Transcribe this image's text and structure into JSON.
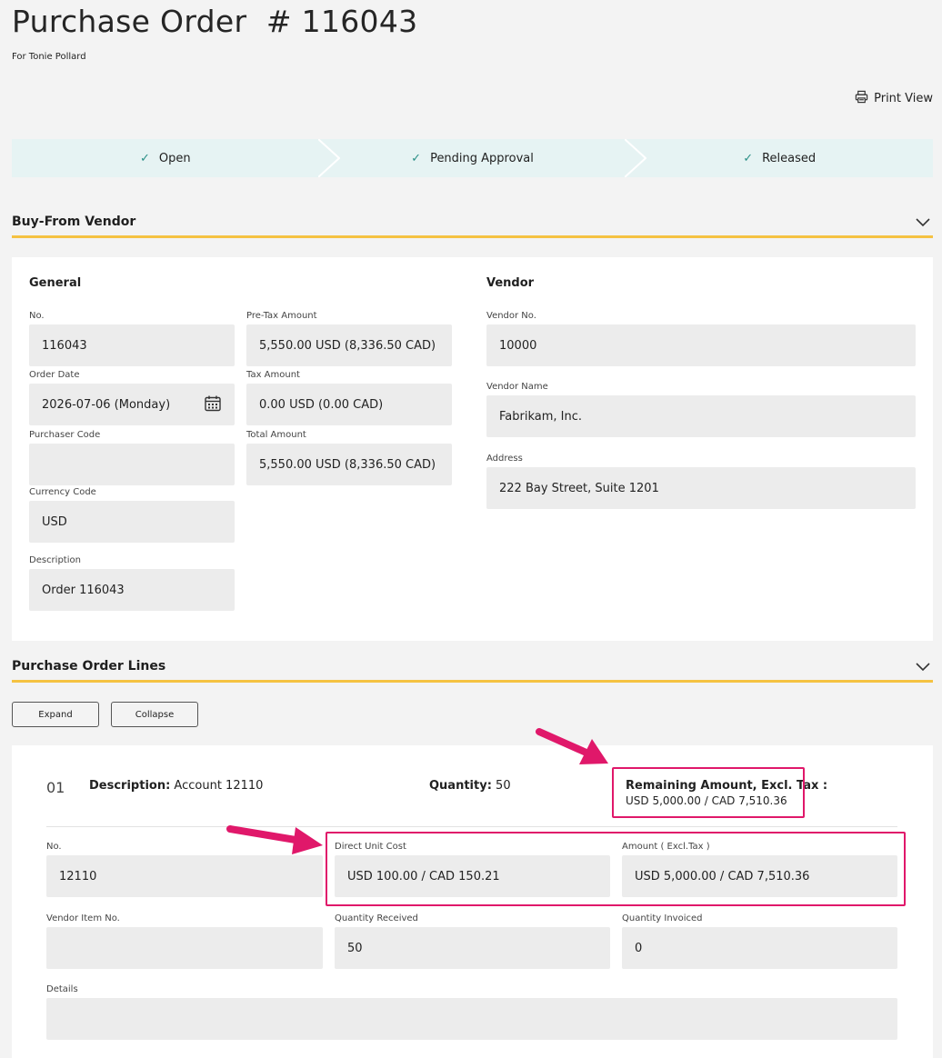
{
  "page": {
    "title": "Purchase Order  # 116043",
    "subtitle": "For Tonie Pollard",
    "print_label": "Print View"
  },
  "status_steps": [
    "Open",
    "Pending Approval",
    "Released"
  ],
  "colors": {
    "accent_underline": "#f5c242",
    "highlight": "#e0186a",
    "check": "#2a8f86",
    "progress_bg": "#e6f3f3"
  },
  "vendor_section": {
    "header": "Buy-From Vendor",
    "general": {
      "title": "General",
      "no_label": "No.",
      "no_value": "116043",
      "order_date_label": "Order Date",
      "order_date_value": "2026-07-06 (Monday)",
      "purchaser_code_label": "Purchaser Code",
      "purchaser_code_value": "",
      "currency_code_label": "Currency Code",
      "currency_code_value": "USD",
      "description_label": "Description",
      "description_value": "Order 116043",
      "pretax_label": "Pre-Tax Amount",
      "pretax_value": "5,550.00 USD (8,336.50 CAD)",
      "tax_label": "Tax Amount",
      "tax_value": "0.00 USD (0.00 CAD)",
      "total_label": "Total Amount",
      "total_value": "5,550.00 USD (8,336.50 CAD)"
    },
    "vendor": {
      "title": "Vendor",
      "vendor_no_label": "Vendor No.",
      "vendor_no_value": "10000",
      "vendor_name_label": "Vendor Name",
      "vendor_name_value": "Fabrikam, Inc.",
      "address_label": "Address",
      "address_value": "222 Bay Street, Suite 1201"
    }
  },
  "lines_section": {
    "header": "Purchase Order Lines",
    "expand_label": "Expand",
    "collapse_label": "Collapse",
    "line": {
      "number": "01",
      "description_label": "Description:",
      "description_value": "Account 12110",
      "quantity_label": "Quantity:",
      "quantity_value": "50",
      "remaining_label": "Remaining Amount, Excl. Tax :",
      "remaining_value": "USD 5,000.00 / CAD 7,510.36",
      "no_label": "No.",
      "no_value": "12110",
      "unit_cost_label": "Direct Unit Cost",
      "unit_cost_value": "USD 100.00 / CAD 150.21",
      "amount_label": "Amount  ( Excl.Tax )",
      "amount_value": "USD 5,000.00 / CAD 7,510.36",
      "vendor_item_label": "Vendor Item No.",
      "vendor_item_value": "",
      "qty_received_label": "Quantity Received",
      "qty_received_value": "50",
      "qty_invoiced_label": "Quantity Invoiced",
      "qty_invoiced_value": "0",
      "details_label": "Details",
      "details_value": ""
    }
  }
}
